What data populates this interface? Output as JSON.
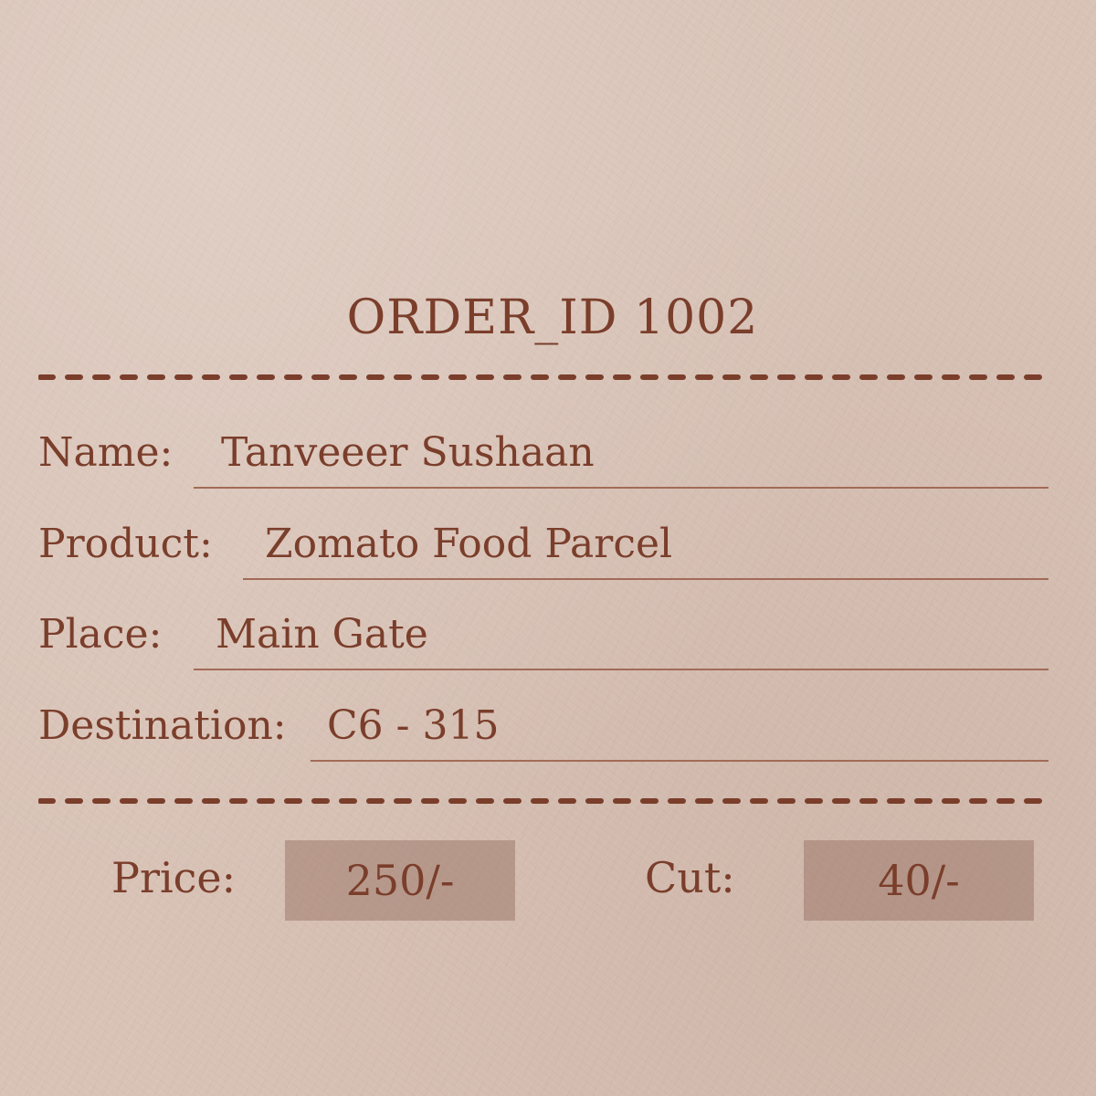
{
  "receipt": {
    "title": "ORDER_ID 1002",
    "fields": [
      {
        "label": "Name:",
        "value": "Tanveeer Sushaan"
      },
      {
        "label": "Product:",
        "value": "Zomato Food Parcel"
      },
      {
        "label": "Place:",
        "value": "Main Gate"
      },
      {
        "label": "Destination:",
        "value": "C6 - 315"
      }
    ],
    "price_label": "Price:",
    "price_value": "250/-",
    "cut_label": "Cut:",
    "cut_value": "40/-"
  },
  "colors": {
    "paper": "#d9c3b7",
    "ink": "#7a3e2b",
    "rule": "#a26b57",
    "box": "#a88a7e"
  }
}
